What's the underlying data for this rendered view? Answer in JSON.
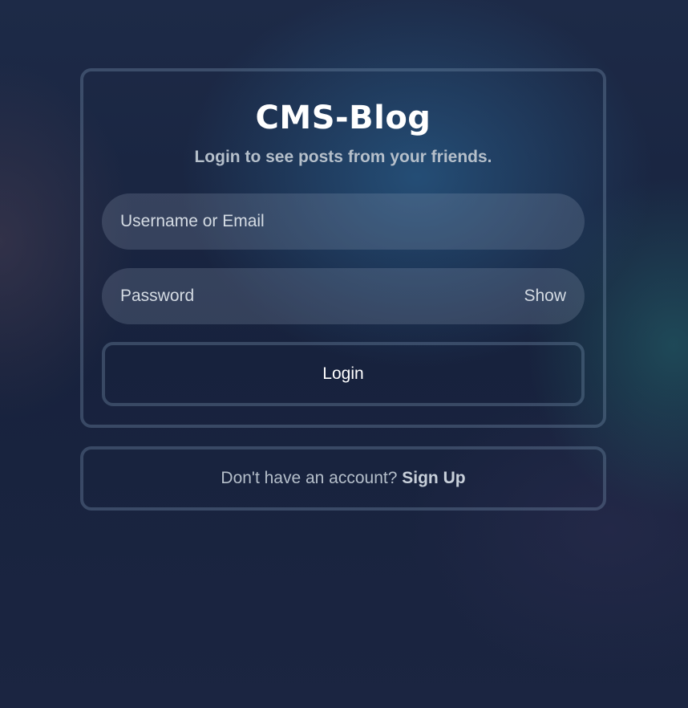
{
  "brand": {
    "title": "CMS-Blog",
    "tagline": "Login to see posts from your friends."
  },
  "form": {
    "username": {
      "placeholder": "Username or Email",
      "value": ""
    },
    "password": {
      "placeholder": "Password",
      "value": "",
      "toggle_label": "Show"
    },
    "login_label": "Login"
  },
  "signup": {
    "prompt": "Don't have an account?",
    "link_label": "Sign Up"
  }
}
